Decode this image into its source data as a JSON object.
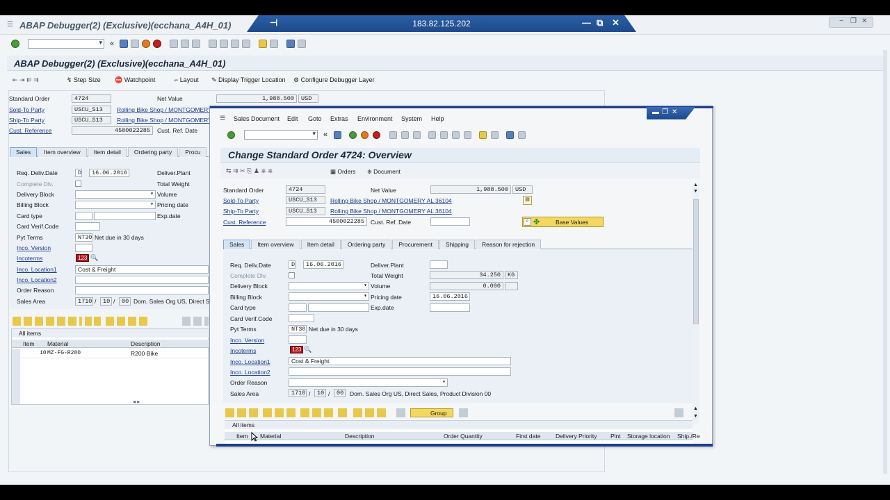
{
  "remote": {
    "ip": "183.82.125.202",
    "pin": "⊣",
    "min": "—",
    "restore": "⧉",
    "close": "✕"
  },
  "bg": {
    "window_title": "ABAP Debugger(2)  (Exclusive)(ecchana_A4H_01)",
    "page_title": "ABAP Debugger(2)  (Exclusive)(ecchana_A4H_01)",
    "toolbar": {
      "step_size": "Step Size",
      "watchpoint": "Watchpoint",
      "layout": "Layout",
      "display_trigger": "Display Trigger Location",
      "configure_layer": "Configure Debugger Layer"
    },
    "header": {
      "standard_order_label": "Standard Order",
      "standard_order_value": "4724",
      "net_value_label": "Net Value",
      "net_value": "1,988.500",
      "currency": "USD",
      "sold_to_label": "Sold-To Party",
      "sold_to_value": "USCU_S13",
      "sold_to_name": "Rolling Bike Shop / MONTGOMERY",
      "ship_to_label": "Ship-To Party",
      "ship_to_value": "USCU_S13",
      "ship_to_name": "Rolling Bike Shop / MONTGOMERY",
      "cust_ref_label": "Cust. Reference",
      "cust_ref_value": "4500022285",
      "cust_ref_date_label": "Cust. Ref. Date"
    },
    "tabs": [
      "Sales",
      "Item overview",
      "Item detail",
      "Ordering party",
      "Procu"
    ],
    "sales": {
      "req_deliv_label": "Req. Deliv.Date",
      "req_deliv_d": "D",
      "req_deliv_date": "16.06.2016",
      "deliver_plant_label": "Deliver.Plant",
      "complete_dlv_label": "Complete Dlv.",
      "total_weight_label": "Total Weight",
      "delivery_block_label": "Delivery Block",
      "volume_label": "Volume",
      "billing_block_label": "Billing Block",
      "pricing_date_label": "Pricing date",
      "card_type_label": "Card type",
      "exp_date_label": "Exp.date",
      "card_verif_label": "Card Verif.Code",
      "pyt_terms_label": "Pyt Terms",
      "pyt_terms_value": "NT30",
      "pyt_terms_text": "Net due in 30 days",
      "inco_version_label": "Inco. Version",
      "incoterms_label": "Incoterms",
      "incoterms_value": "123",
      "inco_loc1_label": "Inco. Location1",
      "inco_loc1_value": "Cost & Freight",
      "inco_loc2_label": "Inco. Location2",
      "order_reason_label": "Order Reason",
      "sales_area_label": "Sales Area",
      "sales_area_org": "1710",
      "sales_area_ch": "10",
      "sales_area_div": "00",
      "sales_area_text": "Dom. Sales Org US, Direct S"
    },
    "items": {
      "section_label": "All items",
      "columns": [
        "Item",
        "Material",
        "Description"
      ],
      "rows": [
        {
          "item": "10",
          "material": "MZ-FG-R200",
          "description": "R200 Bike"
        }
      ]
    }
  },
  "win": {
    "menu": [
      "Sales Document",
      "Edit",
      "Goto",
      "Extras",
      "Environment",
      "System",
      "Help"
    ],
    "title": "Change Standard Order 4724: Overview",
    "app_toolbar": {
      "orders": "Orders",
      "document": "Document"
    },
    "header": {
      "standard_order_label": "Standard Order",
      "standard_order_value": "4724",
      "net_value_label": "Net Value",
      "net_value": "1,988.500",
      "currency": "USD",
      "sold_to_label": "Sold-To Party",
      "sold_to_value": "USCU_S13",
      "sold_to_name": "Rolling Bike Shop / MONTGOMERY AL 36104",
      "ship_to_label": "Ship-To Party",
      "ship_to_value": "USCU_S13",
      "ship_to_name": "Rolling Bike Shop / MONTGOMERY AL 36104",
      "cust_ref_label": "Cust. Reference",
      "cust_ref_value": "4500022285",
      "cust_ref_date_label": "Cust. Ref. Date",
      "base_values": "Base Values"
    },
    "tabs": [
      "Sales",
      "Item overview",
      "Item detail",
      "Ordering party",
      "Procurement",
      "Shipping",
      "Reason for rejection"
    ],
    "sales": {
      "req_deliv_label": "Req. Deliv.Date",
      "req_deliv_d": "D",
      "req_deliv_date": "16.06.2016",
      "deliver_plant_label": "Deliver.Plant",
      "complete_dlv_label": "Complete Dlv.",
      "total_weight_label": "Total Weight",
      "total_weight_value": "34.250",
      "weight_unit": "KG",
      "delivery_block_label": "Delivery Block",
      "volume_label": "Volume",
      "volume_value": "0.000",
      "billing_block_label": "Billing Block",
      "pricing_date_label": "Pricing date",
      "pricing_date_value": "16.06.2016",
      "card_type_label": "Card type",
      "exp_date_label": "Exp.date",
      "card_verif_label": "Card Verif.Code",
      "pyt_terms_label": "Pyt Terms",
      "pyt_terms_value": "NT30",
      "pyt_terms_text": "Net due in 30 days",
      "inco_version_label": "Inco. Version",
      "incoterms_label": "Incoterms",
      "incoterms_value": "123",
      "inco_loc1_label": "Inco. Location1",
      "inco_loc1_value": "Cost & Freight",
      "inco_loc2_label": "Inco. Location2",
      "order_reason_label": "Order Reason",
      "sales_area_label": "Sales Area",
      "sales_area_org": "1710",
      "sales_area_ch": "10",
      "sales_area_div": "00",
      "sales_area_text": "Dom. Sales Org US, Direct Sales, Product Division 00"
    },
    "items": {
      "group_label": "Group",
      "section_label": "All items",
      "columns": [
        "Item",
        "Material",
        "Description",
        "Order Quantity",
        "First date",
        "Delivery Priority",
        "Plnt",
        "Storage location",
        "Ship./Re"
      ]
    }
  }
}
